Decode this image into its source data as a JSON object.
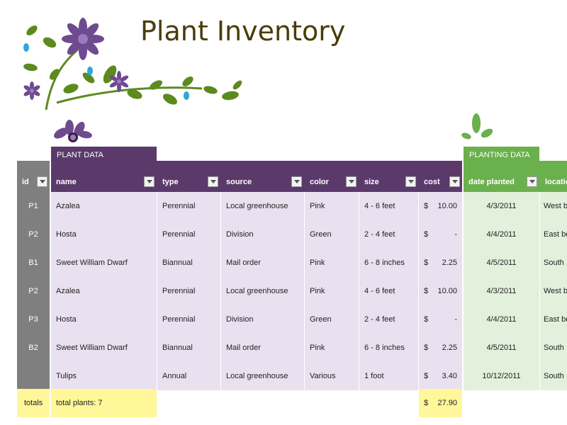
{
  "title": "Plant Inventory",
  "groups": {
    "plant_data": "PLANT DATA",
    "planting_data": "PLANTING DATA"
  },
  "columns": {
    "id": "id",
    "name": "name",
    "type": "type",
    "source": "source",
    "color": "color",
    "size": "size",
    "cost": "cost",
    "date_planted": "date planted",
    "location": "locatio"
  },
  "currency_symbol": "$",
  "rows": [
    {
      "id": "P1",
      "name": "Azalea",
      "type": "Perennial",
      "source": "Local greenhouse",
      "color": "Pink",
      "size": "4 - 6 feet",
      "cost": "10.00",
      "date": "4/3/2011",
      "location": "West b"
    },
    {
      "id": "P2",
      "name": "Hosta",
      "type": "Perennial",
      "source": "Division",
      "color": "Green",
      "size": "2 - 4 feet",
      "cost": "-",
      "date": "4/4/2011",
      "location": "East be"
    },
    {
      "id": "B1",
      "name": "Sweet William Dwarf",
      "type": "Biannual",
      "source": "Mail order",
      "color": "Pink",
      "size": "6 - 8 inches",
      "cost": "2.25",
      "date": "4/5/2011",
      "location": "South"
    },
    {
      "id": "P2",
      "name": "Azalea",
      "type": "Perennial",
      "source": "Local greenhouse",
      "color": "Pink",
      "size": "4 - 6 feet",
      "cost": "10.00",
      "date": "4/3/2011",
      "location": "West b"
    },
    {
      "id": "P3",
      "name": "Hosta",
      "type": "Perennial",
      "source": "Division",
      "color": "Green",
      "size": "2 - 4 feet",
      "cost": "-",
      "date": "4/4/2011",
      "location": "East be"
    },
    {
      "id": "B2",
      "name": "Sweet William Dwarf",
      "type": "Biannual",
      "source": "Mail order",
      "color": "Pink",
      "size": "6 - 8 inches",
      "cost": "2.25",
      "date": "4/5/2011",
      "location": "South"
    },
    {
      "id": "",
      "name": "Tulips",
      "type": "Annual",
      "source": "Local greenhouse",
      "color": "Various",
      "size": "1 foot",
      "cost": "3.40",
      "date": "10/12/2011",
      "location": "South"
    }
  ],
  "totals": {
    "label": "totals",
    "plants": "total plants: 7",
    "cost": "27.90"
  },
  "colors": {
    "purple": "#5b3a6b",
    "green": "#6ab04c",
    "gray": "#7f7f7f",
    "row_purple": "#e9e1ef",
    "row_green": "#e3f0db",
    "totals": "#fff799"
  }
}
